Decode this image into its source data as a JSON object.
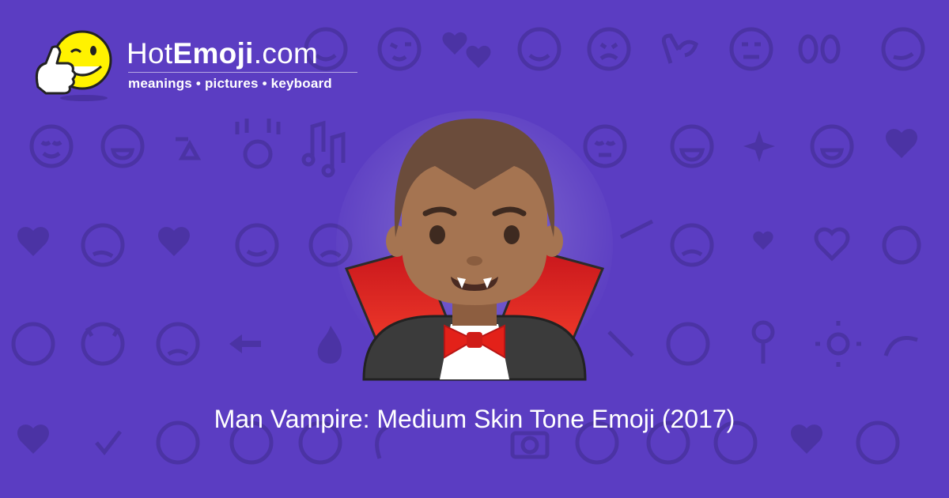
{
  "logo": {
    "brand_prefix": "Hot",
    "brand_bold": "Emoji",
    "brand_suffix": ".com",
    "tagline": "meanings • pictures • keyboard"
  },
  "emoji": {
    "icon": "man-vampire-medium-skin-tone-icon",
    "caption": "Man Vampire: Medium Skin Tone Emoji (2017)"
  },
  "colors": {
    "background": "#5b3dc2",
    "pattern": "#4b33a4",
    "logo_face": "#fff200",
    "skin": "#a57451",
    "hair": "#6b4c3b",
    "cape_red": "#e32119",
    "cape_dark": "#3b3b3b"
  },
  "background_icons": [
    "smiling-face-icon",
    "grinning-face-icon",
    "winking-face-icon",
    "two-hearts-icon",
    "slightly-smiling-face-icon",
    "weary-face-icon",
    "ok-hand-icon",
    "expressionless-face-icon",
    "eyes-icon",
    "smirking-face-icon",
    "relieved-face-icon",
    "recycle-icon",
    "raising-hands-icon",
    "musical-notes-icon",
    "zzz-icon",
    "sparkles-icon",
    "heart-icon",
    "broken-heart-icon",
    "confused-face-icon",
    "tongue-face-icon",
    "arrow-heart-icon",
    "monkey-icon",
    "devil-face-icon",
    "fire-icon",
    "left-arrow-icon",
    "confetti-icon",
    "rose-icon",
    "sun-icon",
    "flexed-biceps-icon",
    "check-mark-icon",
    "cat-face-icon",
    "waving-hand-icon",
    "camera-icon",
    "kissing-face-icon"
  ]
}
